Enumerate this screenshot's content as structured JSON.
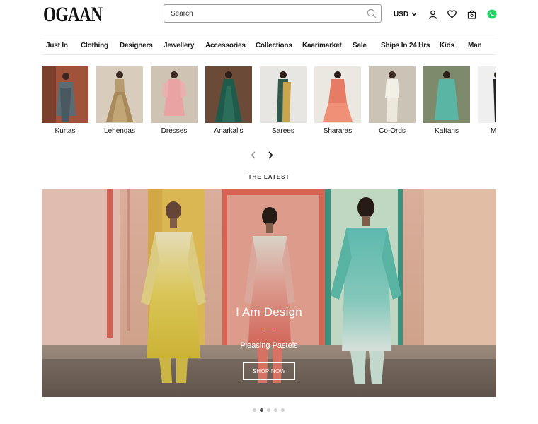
{
  "header": {
    "logo": "OGAAN",
    "search_placeholder": "Search",
    "currency": "USD",
    "icons": [
      "search-icon",
      "user-icon",
      "heart-icon",
      "bag-icon",
      "whatsapp-icon"
    ],
    "whatsapp_color": "#25D366"
  },
  "nav": [
    "Just In",
    "Clothing",
    "Designers",
    "Jewellery",
    "Accessories",
    "Collections",
    "Kaarimarket",
    "Sale",
    "Ships In 24 Hrs",
    "Kids",
    "Man"
  ],
  "categories": [
    {
      "label": "Kurtas"
    },
    {
      "label": "Lehengas"
    },
    {
      "label": "Dresses"
    },
    {
      "label": "Anarkalis"
    },
    {
      "label": "Sarees"
    },
    {
      "label": "Shararas"
    },
    {
      "label": "Co-Ords"
    },
    {
      "label": "Kaftans"
    },
    {
      "label": "M"
    }
  ],
  "section": {
    "latest": "THE LATEST"
  },
  "hero": {
    "title": "I Am Design",
    "subtitle": "Pleasing Pastels",
    "cta": "SHOP NOW",
    "slide_count": 5,
    "active_slide": 2
  },
  "colors": {
    "accent": "#1a1a1a",
    "border": "#9a9a9a"
  }
}
